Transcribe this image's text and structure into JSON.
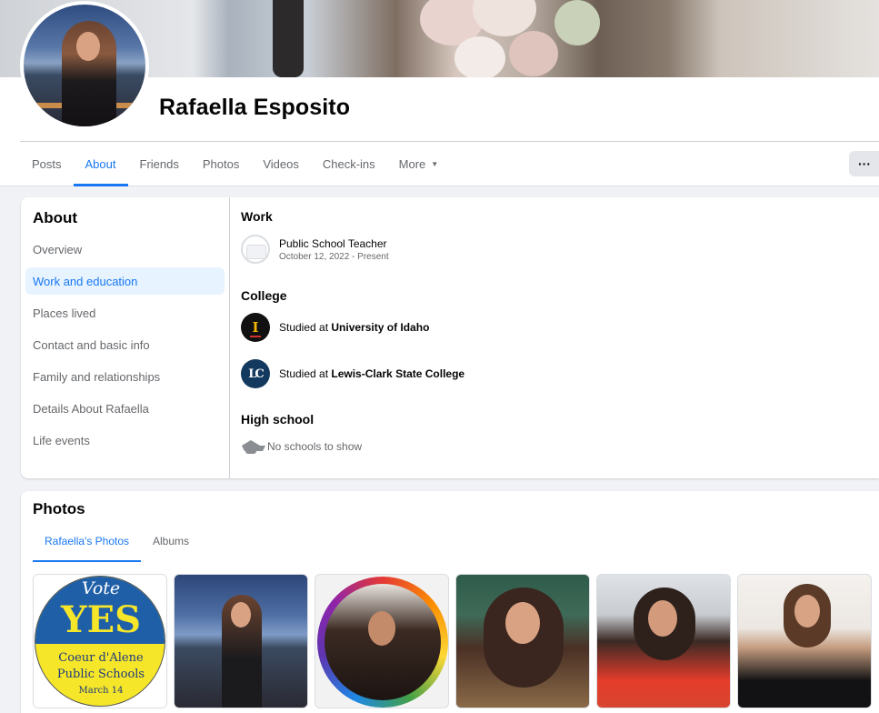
{
  "profile": {
    "name": "Rafaella Esposito"
  },
  "tabs": [
    {
      "label": "Posts"
    },
    {
      "label": "About"
    },
    {
      "label": "Friends"
    },
    {
      "label": "Photos"
    },
    {
      "label": "Videos"
    },
    {
      "label": "Check-ins"
    },
    {
      "label": "More"
    }
  ],
  "more_button": {
    "label": "···"
  },
  "about": {
    "title": "About",
    "nav": [
      {
        "label": "Overview"
      },
      {
        "label": "Work and education"
      },
      {
        "label": "Places lived"
      },
      {
        "label": "Contact and basic info"
      },
      {
        "label": "Family and relationships"
      },
      {
        "label": "Details About Rafaella"
      },
      {
        "label": "Life events"
      }
    ],
    "work": {
      "title": "Work",
      "job": "Public School Teacher",
      "dates": "October 12, 2022 - Present"
    },
    "college": {
      "title": "College",
      "entries": [
        {
          "prefix": "Studied at ",
          "school": "University of Idaho",
          "logo": "I"
        },
        {
          "prefix": "Studied at ",
          "school": "Lewis-Clark State College",
          "logo": "LC"
        }
      ]
    },
    "high_school": {
      "title": "High school",
      "empty": "No schools to show"
    }
  },
  "photos": {
    "title": "Photos",
    "tabs": [
      {
        "label": "Rafaella's Photos"
      },
      {
        "label": "Albums"
      }
    ],
    "vote_sign": {
      "vote": "Vote",
      "yes": "YES",
      "line1": "Coeur d'Alene",
      "line2": "Public Schools",
      "date": "March 14"
    }
  },
  "colors": {
    "accent": "#1877f2",
    "secondary_text": "#65676b",
    "active_nav_bg": "#e7f3ff"
  }
}
